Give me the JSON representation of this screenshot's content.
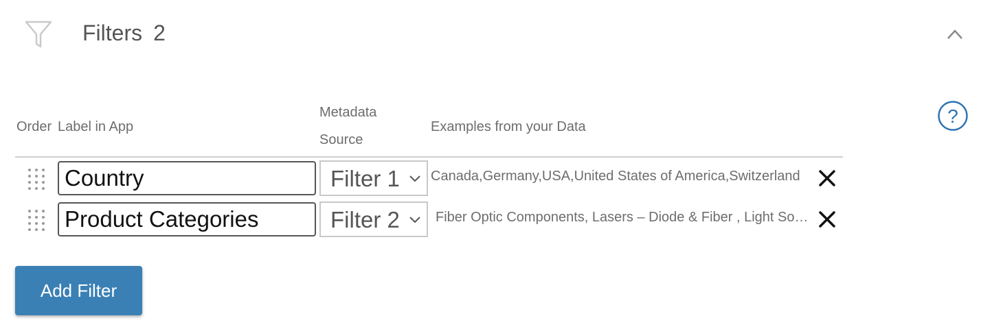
{
  "header": {
    "title": "Filters",
    "count": "2",
    "filter_icon": "filter-funnel-icon",
    "collapse_icon": "chevron-up-icon"
  },
  "help_icon": "help-circle-icon",
  "table": {
    "columns": {
      "order": "Order",
      "label": "Label in App",
      "source": "Metadata Source",
      "examples": "Examples from your Data"
    },
    "rows": [
      {
        "label_value": "Country",
        "source_value": "Filter 1",
        "examples": "Canada,Germany,USA,United States of America,Switzerland"
      },
      {
        "label_value": "Product Categories",
        "source_value": "Filter 2",
        "examples": "Fiber Optic Components, Lasers – Diode & Fiber , Light Sources"
      }
    ]
  },
  "add_button_label": "Add Filter",
  "colors": {
    "accent": "#3b80b5",
    "help": "#2f74b2",
    "text": "#555555"
  }
}
